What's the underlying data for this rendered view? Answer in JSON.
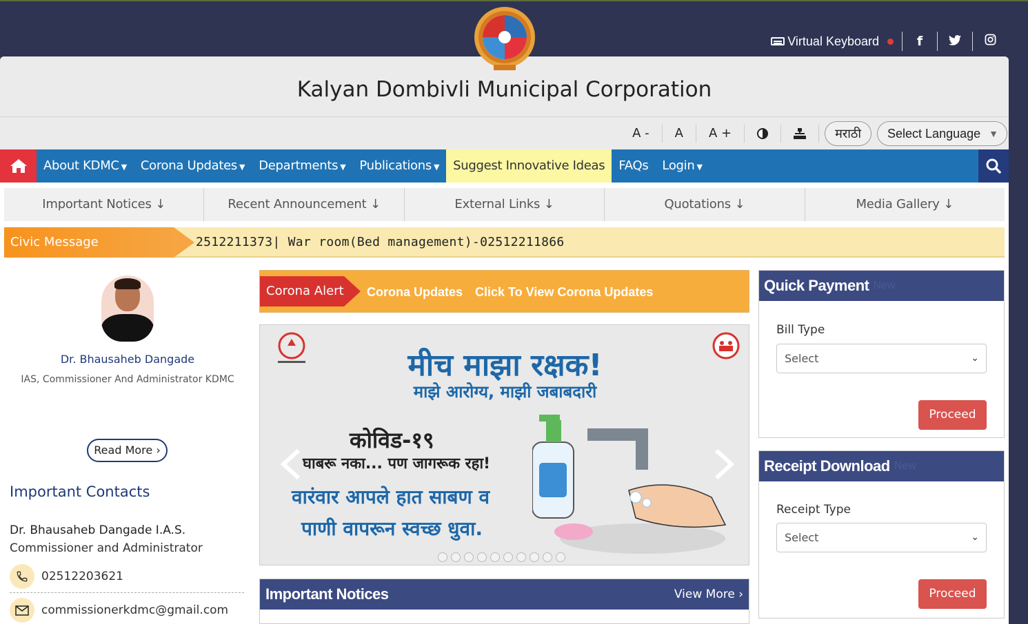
{
  "top": {
    "virtual_keyboard": "Virtual Keyboard",
    "social": [
      "facebook-icon",
      "twitter-icon",
      "instagram-icon"
    ]
  },
  "header": {
    "title": "Kalyan Dombivli Municipal Corporation"
  },
  "toolbar": {
    "font_decrease": "A -",
    "font_normal": "A",
    "font_increase": "A +",
    "marathi": "मराठी",
    "language": "Select Language"
  },
  "nav": {
    "items": [
      "About KDMC",
      "Corona Updates",
      "Departments",
      "Publications",
      "Suggest Innovative Ideas",
      "FAQs",
      "Login"
    ]
  },
  "tabs": [
    "Important Notices ↓",
    "Recent Announcement ↓",
    "External Links ↓",
    "Quotations ↓",
    "Media Gallery ↓"
  ],
  "civic": {
    "label": "Civic Message",
    "message": "2512211373| War room(Bed management)-02512211866"
  },
  "profile": {
    "name": "Dr. Bhausaheb Dangade",
    "role": "IAS, Commissioner And Administrator KDMC",
    "read_more": "Read More"
  },
  "contacts": {
    "heading": "Important Contacts",
    "name": "Dr. Bhausaheb Dangade I.A.S.",
    "role": "Commissioner and Administrator",
    "phone": "02512203621",
    "email": "commissionerkdmc@gmail.com"
  },
  "alert": {
    "label": "Corona Alert",
    "link1": "Corona Updates",
    "link2": "Click To View Corona Updates"
  },
  "slider": {
    "title1": "मीच माझा रक्षक!",
    "title2": "माझे आरोग्य, माझी जबाबदारी",
    "line1": "कोविड-१९",
    "line2": "घाबरू नका... पण जागरूक रहा!",
    "line3": "वारंवार आपले हात साबण व",
    "line4": "पाणी वापरून स्वच्छ धुवा.",
    "dot_count": 10
  },
  "notices": {
    "title": "Important Notices",
    "view_more": "View More"
  },
  "quick_payment": {
    "title": "Quick Payment",
    "new_badge": "New",
    "label": "Bill Type",
    "select": "Select",
    "button": "Proceed"
  },
  "receipt": {
    "title": "Receipt Download",
    "new_badge": "New",
    "label": "Receipt Type",
    "select": "Select",
    "button": "Proceed"
  },
  "colors": {
    "nav_blue": "#1f73b5",
    "home_red": "#e4333d",
    "panel_header": "#3c4a82",
    "proceed_red": "#d9534f",
    "civic_orange": "#f7931e"
  }
}
